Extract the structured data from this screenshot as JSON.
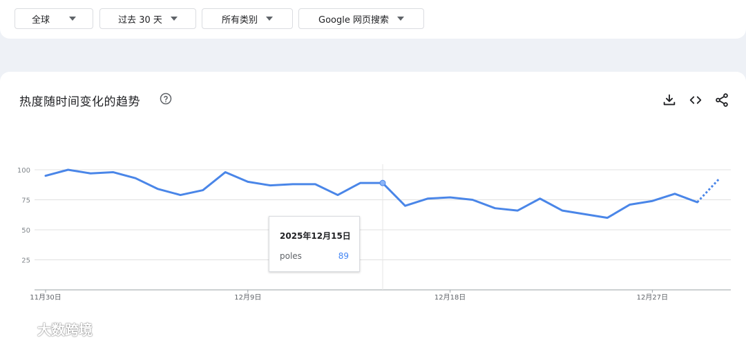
{
  "filters": {
    "region": "全球",
    "time": "过去 30 天",
    "category": "所有类别",
    "search_type": "Google 网页搜索"
  },
  "card": {
    "title": "热度随时间变化的趋势"
  },
  "icons": {
    "help": "help-circle-icon",
    "download": "download-icon",
    "embed": "code-icon",
    "share": "share-icon"
  },
  "tooltip": {
    "date": "2025年12月15日",
    "term": "poles",
    "value": "89"
  },
  "watermark": {
    "text": "大数跨境"
  },
  "colors": {
    "line": "#4a86e8",
    "grid": "#e0e0e0",
    "tooltip_value": "#4285f4"
  },
  "chart_data": {
    "type": "line",
    "x": [
      "11月30日",
      "12月1日",
      "12月2日",
      "12月3日",
      "12月4日",
      "12月5日",
      "12月6日",
      "12月7日",
      "12月8日",
      "12月9日",
      "12月10日",
      "12月11日",
      "12月12日",
      "12月13日",
      "12月14日",
      "12月15日",
      "12月16日",
      "12月17日",
      "12月18日",
      "12月19日",
      "12月20日",
      "12月21日",
      "12月22日",
      "12月23日",
      "12月24日",
      "12月25日",
      "12月26日",
      "12月27日",
      "12月28日",
      "12月29日"
    ],
    "series": [
      {
        "name": "poles",
        "values": [
          95,
          100,
          97,
          98,
          93,
          84,
          79,
          83,
          98,
          90,
          87,
          88,
          88,
          79,
          89,
          89,
          70,
          76,
          77,
          75,
          68,
          66,
          76,
          66,
          63,
          60,
          71,
          74,
          80,
          73
        ],
        "partial_last_value": 93
      }
    ],
    "xticks": [
      {
        "index": 0,
        "label": "11月30日"
      },
      {
        "index": 9,
        "label": "12月9日"
      },
      {
        "index": 18,
        "label": "12月18日"
      },
      {
        "index": 27,
        "label": "12月27日"
      }
    ],
    "yticks": [
      25,
      50,
      75,
      100
    ],
    "ylim": [
      0,
      100
    ],
    "highlight_index": 15,
    "grid": true
  }
}
